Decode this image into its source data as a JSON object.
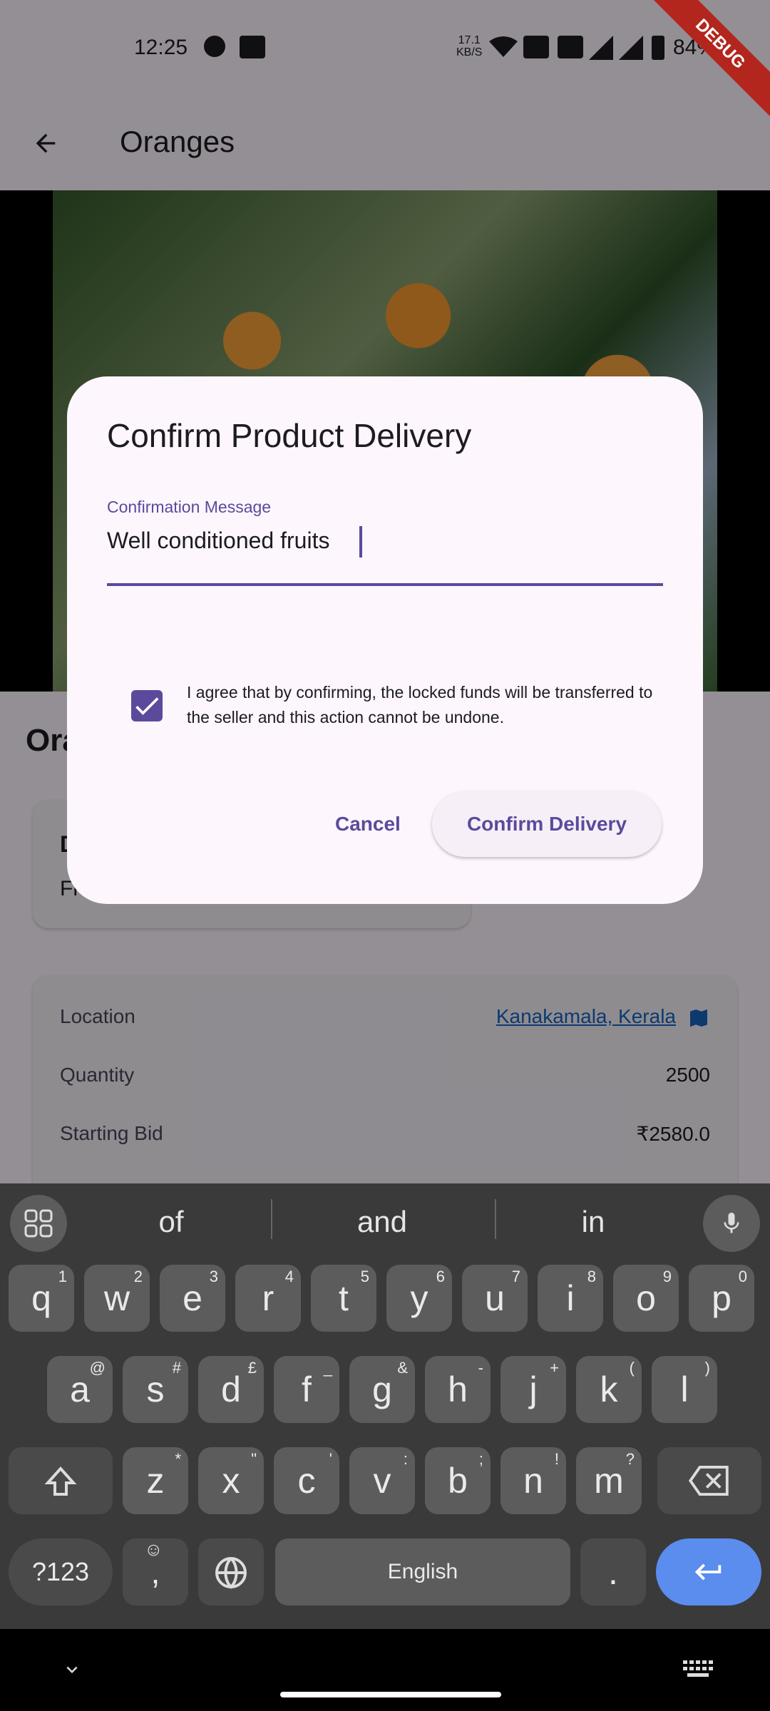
{
  "status_bar": {
    "time": "12:25",
    "network_speed": "17.1",
    "network_unit": "KB/S",
    "battery": "84%",
    "debug_label": "DEBUG"
  },
  "app_bar": {
    "title": "Oranges"
  },
  "product": {
    "title_partial": "Ora",
    "card_title_partial": "D",
    "card_sub_partial": "Fre"
  },
  "details": {
    "location_label": "Location",
    "location_value": "Kanakamala, Kerala",
    "quantity_label": "Quantity",
    "quantity_value": "2500",
    "bid_label": "Starting Bid",
    "bid_value": "₹2580.0"
  },
  "dialog": {
    "title": "Confirm Product Delivery",
    "field_label": "Confirmation Message",
    "field_value": "Well conditioned fruits ",
    "checkbox_checked": true,
    "agreement_text": "I agree that by confirming, the locked funds will be transferred to the seller and this action cannot be undone.",
    "cancel_label": "Cancel",
    "confirm_label": "Confirm Delivery",
    "accent_color": "#5b4a9c"
  },
  "keyboard": {
    "suggestions": [
      "of",
      "and",
      "in"
    ],
    "row1": [
      {
        "k": "q",
        "s": "1"
      },
      {
        "k": "w",
        "s": "2"
      },
      {
        "k": "e",
        "s": "3"
      },
      {
        "k": "r",
        "s": "4"
      },
      {
        "k": "t",
        "s": "5"
      },
      {
        "k": "y",
        "s": "6"
      },
      {
        "k": "u",
        "s": "7"
      },
      {
        "k": "i",
        "s": "8"
      },
      {
        "k": "o",
        "s": "9"
      },
      {
        "k": "p",
        "s": "0"
      }
    ],
    "row2": [
      {
        "k": "a",
        "s": "@"
      },
      {
        "k": "s",
        "s": "#"
      },
      {
        "k": "d",
        "s": "£"
      },
      {
        "k": "f",
        "s": "_"
      },
      {
        "k": "g",
        "s": "&"
      },
      {
        "k": "h",
        "s": "-"
      },
      {
        "k": "j",
        "s": "+"
      },
      {
        "k": "k",
        "s": "("
      },
      {
        "k": "l",
        "s": ")"
      }
    ],
    "row3": [
      {
        "k": "z",
        "s": "*"
      },
      {
        "k": "x",
        "s": "\""
      },
      {
        "k": "c",
        "s": "'"
      },
      {
        "k": "v",
        "s": ":"
      },
      {
        "k": "b",
        "s": ";"
      },
      {
        "k": "n",
        "s": "!"
      },
      {
        "k": "m",
        "s": "?"
      }
    ],
    "symbols_label": "?123",
    "comma_label": ",",
    "space_label": "English",
    "period_label": "."
  }
}
